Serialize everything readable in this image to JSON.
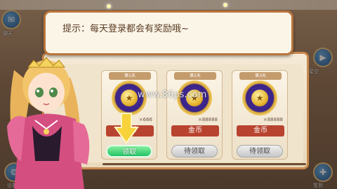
{
  "dialog": {
    "text": "提示：每天登录都会有奖励哦~"
  },
  "watermark": "www.86ps.com",
  "side": {
    "left_top_label": "聊天",
    "right_label": "星空",
    "right_bottom_label": "签到",
    "left_bottom_label": "设置"
  },
  "cards": [
    {
      "title": "第1天",
      "reward": "金币",
      "qty": "×666",
      "button": "领取",
      "state": "claim"
    },
    {
      "title": "第2天",
      "reward": "金币",
      "qty": "×88888",
      "button": "待领取",
      "state": "pending"
    },
    {
      "title": "第3天",
      "reward": "金币",
      "qty": "×88888",
      "button": "待领取",
      "state": "pending"
    }
  ],
  "colors": {
    "claim_button": "#22c265",
    "pending_button": "#c7c7c7",
    "reward_plate": "#b8432e",
    "dialog_border": "#b8753b"
  },
  "icons": {
    "coin": "star-coin-icon",
    "arrow": "down-arrow-icon"
  }
}
